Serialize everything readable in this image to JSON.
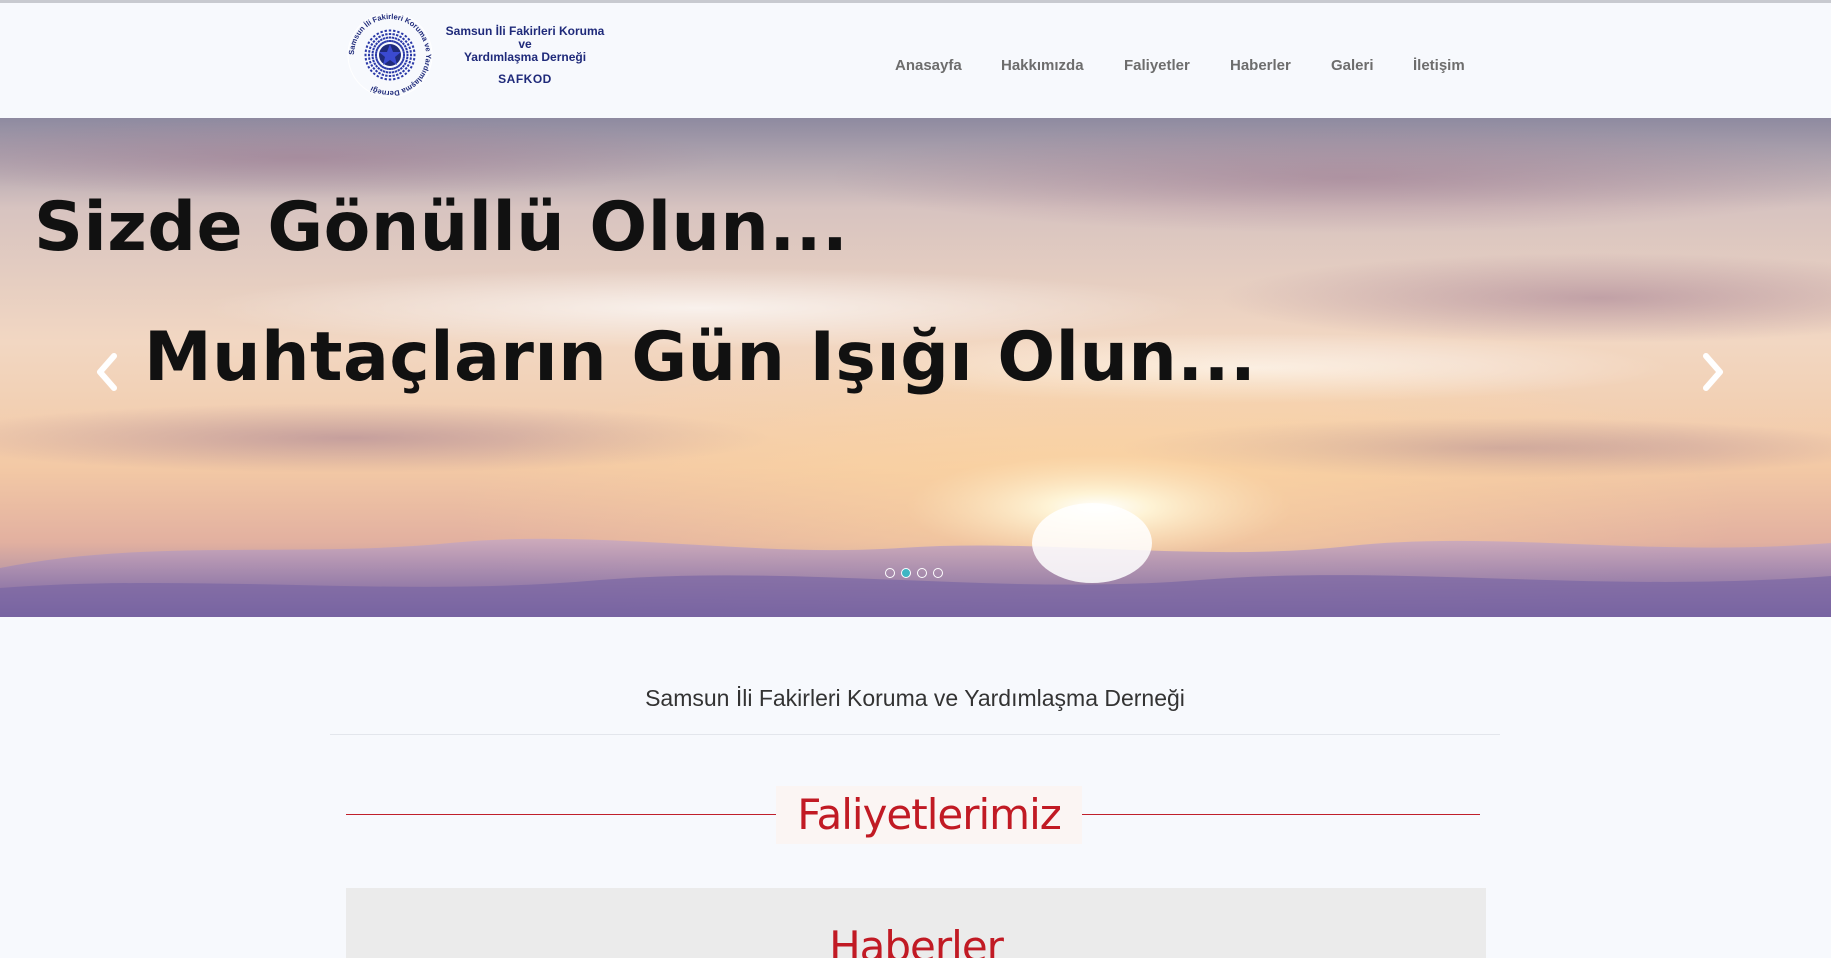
{
  "logo": {
    "line1": "Samsun İli Fakirleri Koruma",
    "line2": "ve",
    "line3": "Yardımlaşma Derneği",
    "abbr": "SAFKOD",
    "ring_text": "Samsun İli Fakirleri Koruma ve Yardımlaşma Derneği"
  },
  "nav": {
    "items": [
      {
        "label": "Anasayfa"
      },
      {
        "label": "Hakkımızda"
      },
      {
        "label": "Faliyetler"
      },
      {
        "label": "Haberler"
      },
      {
        "label": "Galeri"
      },
      {
        "label": "İletişim"
      }
    ]
  },
  "slider": {
    "line1": "Sizde Gönüllü Olun...",
    "line2": "Muhtaçların Gün Işığı Olun...",
    "dots_count": 4,
    "active_dot": 2,
    "prev_icon": "chevron-left-icon",
    "next_icon": "chevron-right-icon"
  },
  "main": {
    "subtitle": "Samsun İli Fakirleri Koruma ve Yardımlaşma Derneği",
    "section_title": "Faliyetlerimiz",
    "news_title": "Haberler"
  },
  "colors": {
    "accent": "#c11a24",
    "nav_text": "#6d6d6d",
    "logo_blue": "#1f2a7a",
    "dot_active": "#3fb6c4"
  }
}
